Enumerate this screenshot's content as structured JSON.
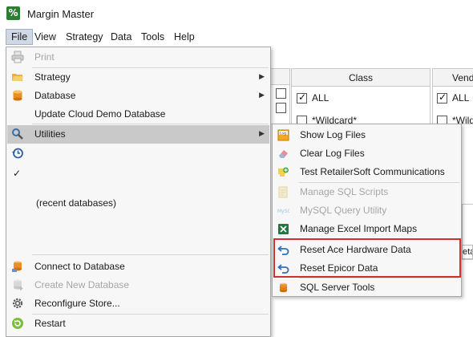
{
  "app": {
    "title": "Margin Master",
    "icon_text": "%"
  },
  "menubar": {
    "items": [
      {
        "label": "File"
      },
      {
        "label": "View"
      },
      {
        "label": "Strategy"
      },
      {
        "label": "Data"
      },
      {
        "label": "Tools"
      },
      {
        "label": "Help"
      }
    ]
  },
  "background": {
    "class_header": "Class",
    "vendor_header": "Vend",
    "class_all": "ALL",
    "class_wildcard": "*Wildcard*",
    "vendor_all": "ALL",
    "vendor_wildcard": "*Wildca",
    "partial_field": "eta"
  },
  "file_menu": {
    "print": "Print",
    "strategy": "Strategy",
    "database": "Database",
    "update_cloud": "Update Cloud Demo Database",
    "utilities": "Utilities",
    "recent_databases": "(recent databases)",
    "connect": "Connect to Database",
    "create_new": "Create New Database",
    "reconfigure": "Reconfigure Store...",
    "restart": "Restart"
  },
  "utilities_menu": {
    "show_log": "Show Log Files",
    "clear_log": "Clear Log Files",
    "test_comm": "Test RetailerSoft Communications",
    "manage_sql": "Manage SQL Scripts",
    "mysql_query": "MySQL Query Utility",
    "excel_maps": "Manage Excel Import Maps",
    "reset_ace": "Reset Ace Hardware Data",
    "reset_epicor": "Reset Epicor Data",
    "sql_server": "SQL Server Tools"
  },
  "colors": {
    "accent_highlight": "#d32f2f",
    "app_icon": "#2e7d32",
    "menu_highlight": "#c9c9c9"
  }
}
